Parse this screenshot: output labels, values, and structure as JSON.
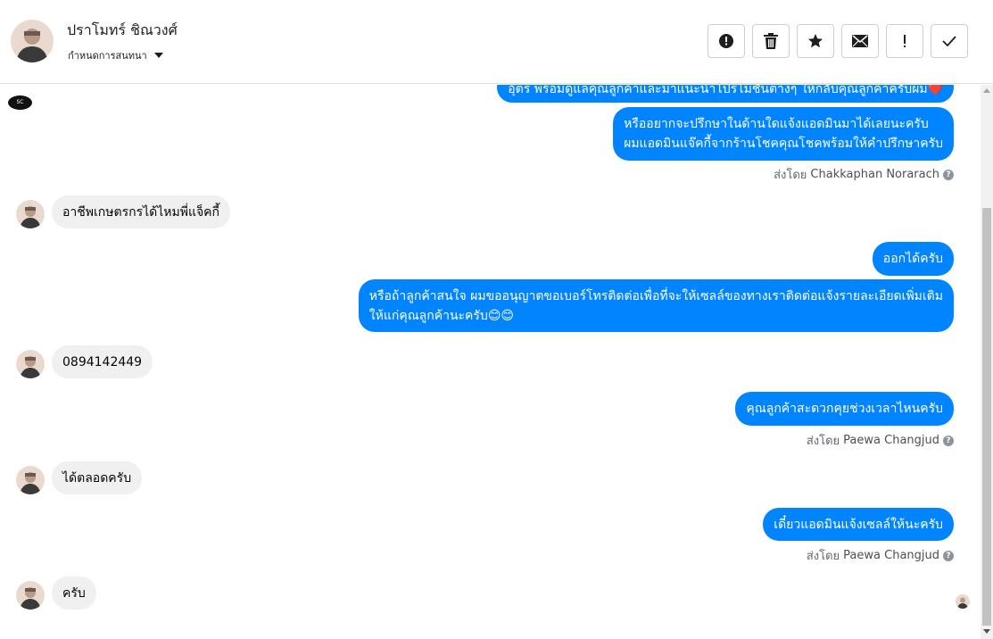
{
  "header": {
    "contact_name": "ปราโมทร์ ชิณวงศ์",
    "label_dropdown": "กำหนดการสนทนา",
    "toolbar": [
      {
        "name": "mark-spam-button",
        "icon": "alert-circle-icon"
      },
      {
        "name": "delete-button",
        "icon": "trash-icon"
      },
      {
        "name": "star-button",
        "icon": "star-icon"
      },
      {
        "name": "mark-unread-button",
        "icon": "envelope-icon"
      },
      {
        "name": "follow-up-button",
        "icon": "exclamation-icon"
      },
      {
        "name": "mark-done-button",
        "icon": "check-icon"
      }
    ]
  },
  "colors": {
    "outgoing": "#0084ff",
    "incoming": "#f0f0f0",
    "sent_by_text": "#606770"
  },
  "messages": {
    "m1": "อุ๊ตร พร้อมดูแลคุณลูกค้าและมาแนะนำโปรโมชั่นต่างๆ ให้กลับคุณลูกค้าครับผม❤️",
    "m2_line1": "หรืออยากจะปรึกษาในด้านใดแจ้งแอดมินมาได้เลยนะครับ",
    "m2_line2": "ผมแอดมินแจ๊คกี้จากร้านโชคคุณโชคพร้อมให้คำปรึกษาครับ",
    "m2_sentby_prefix": "ส่งโดย",
    "m2_sentby_name": "Chakkaphan Norarach",
    "m3": "อาชีพเกษตรกรได้ไหมพี่แจ็คกี้",
    "m4": "ออกได้ครับ",
    "m5_line1": "หรือถ้าลูกค้าสนใจ ผมขออนุญาตขอเบอร์โทรติดต่อเพื่อที่จะให้เซลล์ของทางเราติดต่อแจ้งรายละเอียดเพิ่มเติม",
    "m5_line2": "ให้แก่คุณลูกค้านะครับ😊😊",
    "m6": "0894142449",
    "m7": "คุณลูกค้าสะดวกคุยช่วงเวลาไหนครับ",
    "m7_sentby_prefix": "ส่งโดย",
    "m7_sentby_name": "Paewa Changjud",
    "m8": "ได้ตลอดครับ",
    "m9": "เดี๋ยวแอดมินแจ้งเซลล์ให้นะครับ",
    "m9_sentby_prefix": "ส่งโดย",
    "m9_sentby_name": "Paewa Changjud",
    "m10": "ครับ"
  }
}
